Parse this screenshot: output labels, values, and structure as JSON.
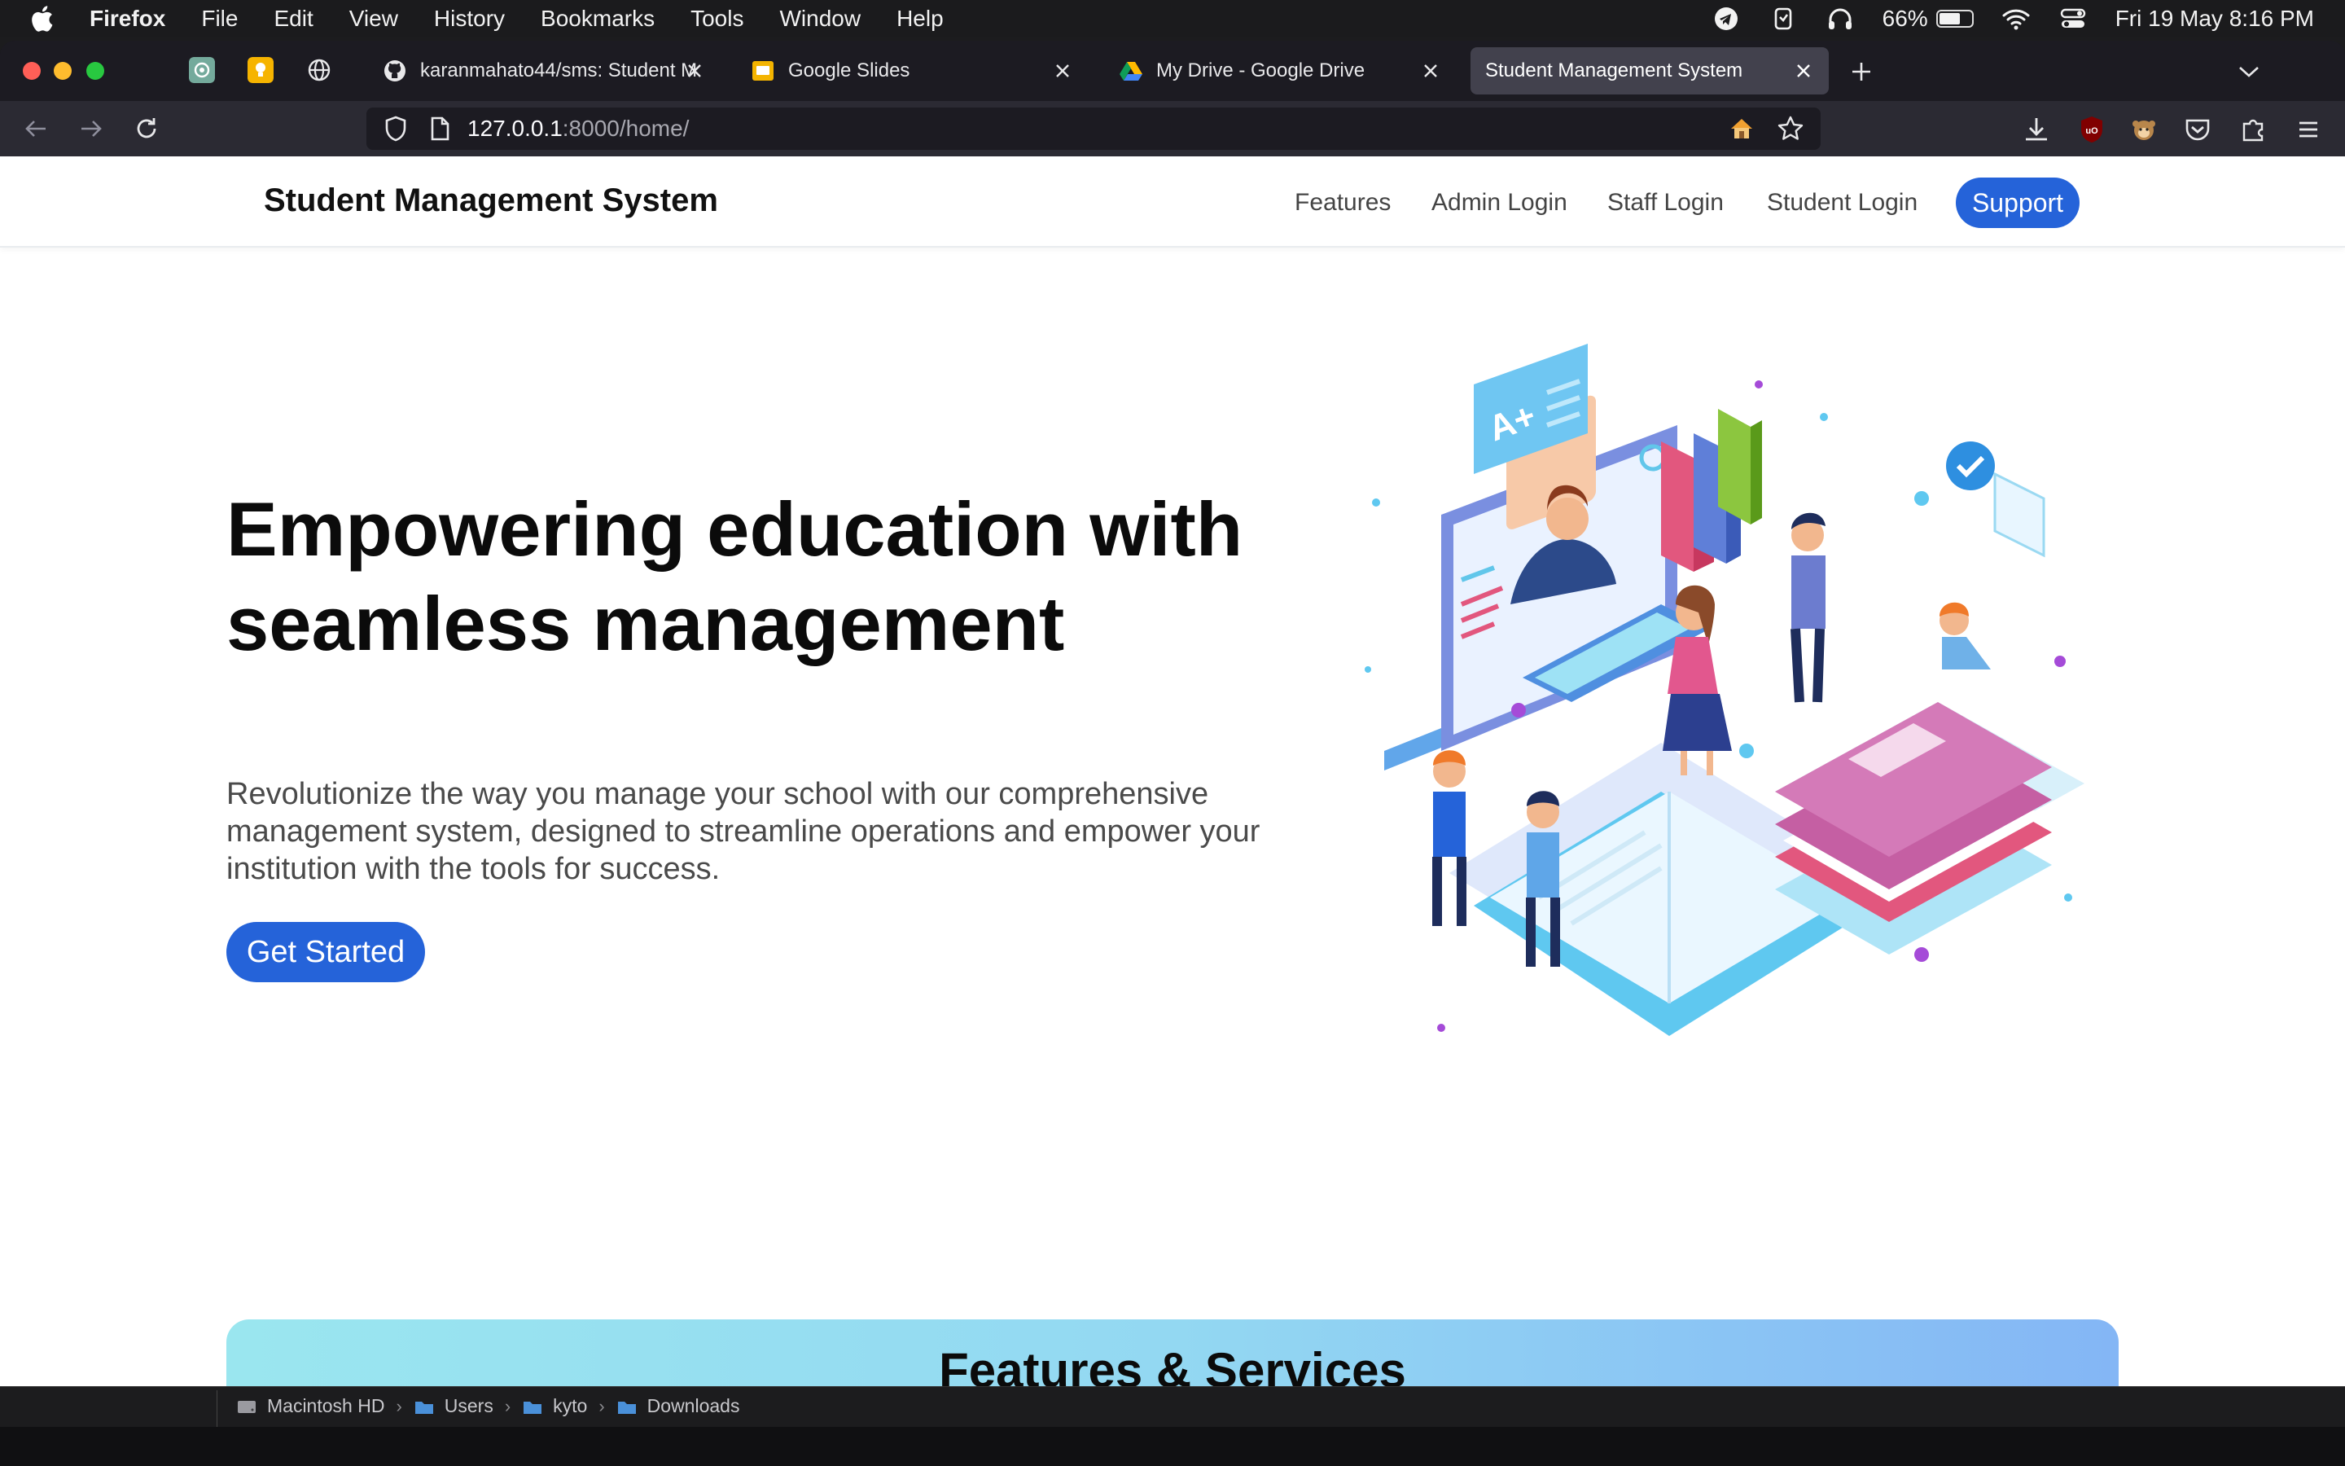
{
  "menubar": {
    "app_name": "Firefox",
    "items": [
      "File",
      "Edit",
      "View",
      "History",
      "Bookmarks",
      "Tools",
      "Window",
      "Help"
    ],
    "battery_percent": "66%",
    "battery_level": 0.66,
    "datetime": "Fri 19 May  8:16 PM"
  },
  "tabs": [
    {
      "title": "karanmahato44/sms: Student M",
      "icon": "github-icon"
    },
    {
      "title": "Google Slides",
      "icon": "google-slides-icon"
    },
    {
      "title": "My Drive - Google Drive",
      "icon": "google-drive-icon"
    },
    {
      "title": "Student Management System",
      "icon": "none",
      "active": true
    }
  ],
  "url": {
    "host": "127.0.0.1",
    "path": ":8000/home/"
  },
  "site": {
    "brand": "Student Management System",
    "nav": [
      "Features",
      "Admin Login",
      "Staff Login",
      "Student Login"
    ],
    "support_label": "Support",
    "hero_title": "Empowering education with seamless management",
    "hero_subtitle": "Revolutionize the way you manage your school with our comprehensive management system, designed to streamline operations and empower your institution with the tools for success.",
    "cta_label": "Get Started",
    "features_title": "Features & Services",
    "accent_color": "#2563d9"
  },
  "statusbar": {
    "path": [
      "Macintosh HD",
      "Users",
      "kyto",
      "Downloads"
    ]
  }
}
